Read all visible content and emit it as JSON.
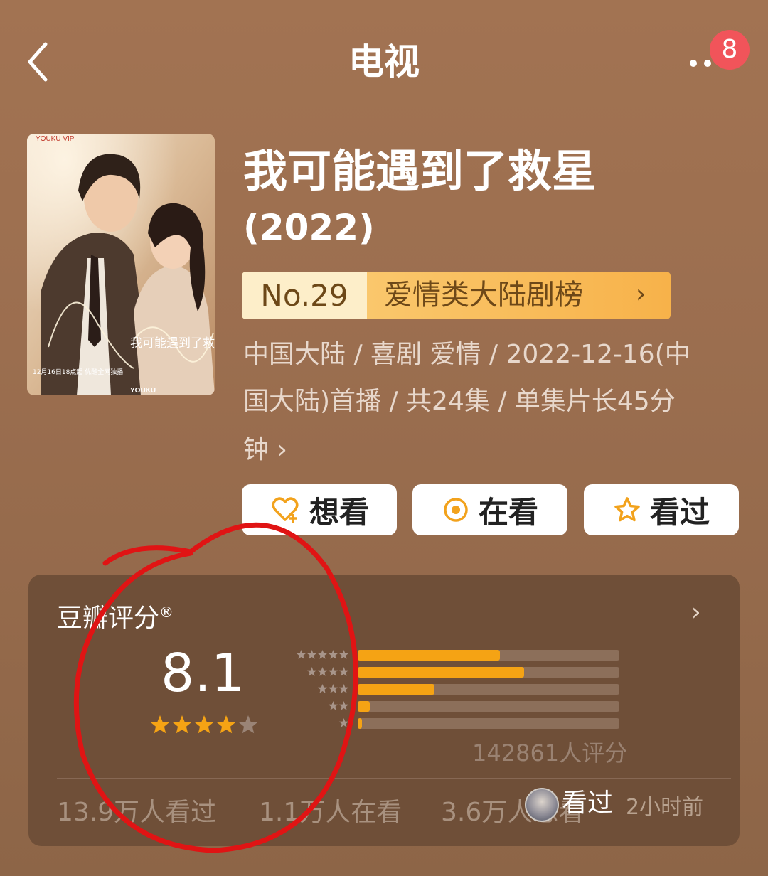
{
  "header": {
    "title": "电视",
    "notification_count": "8"
  },
  "show": {
    "title": "我可能遇到了救星",
    "year": "(2022)",
    "rank_number": "No.29",
    "rank_label": "爱情类大陆剧榜",
    "meta_lines": [
      "中国大陆 / 喜剧  爱情 / 2022-12-16(中",
      "国大陆)首播 / 共24集 / 单集片长45分",
      "钟 ›"
    ],
    "poster": {
      "brand_top": "YOUKU VIP",
      "title_overlay": "我可能遇到了救星",
      "release_note": "12月16日18点起 优酷全网独播",
      "brand_bottom": "YOUKU"
    }
  },
  "actions": {
    "want": "想看",
    "watching": "在看",
    "watched": "看过"
  },
  "rating": {
    "title": "豆瓣评分",
    "registered_mark": "®",
    "score": "8.1",
    "stars": 4,
    "distribution_percent": [
      35,
      41,
      19,
      3,
      1
    ],
    "rating_count": "142861人评分",
    "stats": {
      "watched": "13.9万人看过",
      "watching": "1.1万人在看",
      "want": "3.6万人想看"
    },
    "toast": {
      "text": "看过",
      "time": "2小时前"
    }
  },
  "colors": {
    "background": "#9c6f50",
    "card": "#6f4f38",
    "accent": "#f5a314",
    "badge": "#f1545a",
    "annotation": "#e01414"
  }
}
